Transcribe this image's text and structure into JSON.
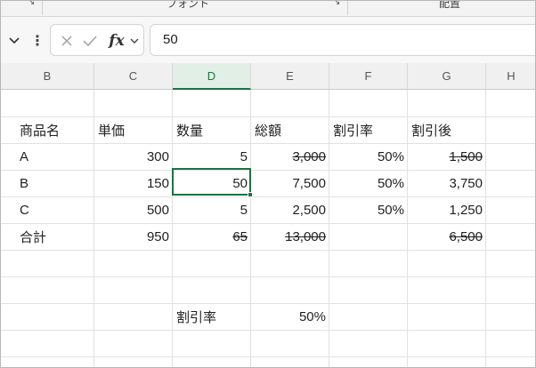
{
  "ribbon": {
    "font_group": "フォント",
    "alignment_group": "配置",
    "launcher_glyph": "↘"
  },
  "formula_bar": {
    "cancel_icon": "×",
    "enter_icon": "✓",
    "fx_label": "fx",
    "value": "50"
  },
  "columns": [
    "B",
    "C",
    "D",
    "E",
    "F",
    "G",
    "H"
  ],
  "active_column": "D",
  "table": {
    "headers": [
      "商品名",
      "単価",
      "数量",
      "総額",
      "割引率",
      "割引後"
    ],
    "rows": [
      {
        "name": "A",
        "price": "300",
        "qty": "5",
        "total": "3,000",
        "rate": "50%",
        "after": "1,500"
      },
      {
        "name": "B",
        "price": "150",
        "qty": "50",
        "total": "7,500",
        "rate": "50%",
        "after": "3,750"
      },
      {
        "name": "C",
        "price": "500",
        "qty": "5",
        "total": "2,500",
        "rate": "50%",
        "after": "1,250"
      }
    ],
    "total_row": {
      "name": "合計",
      "price": "950",
      "qty": "65",
      "total": "13,000",
      "after": "6,500"
    }
  },
  "discount": {
    "label": "割引率",
    "value": "50%"
  },
  "colors": {
    "accent": "#1e7145",
    "active_header_bg": "#e1efe6"
  }
}
